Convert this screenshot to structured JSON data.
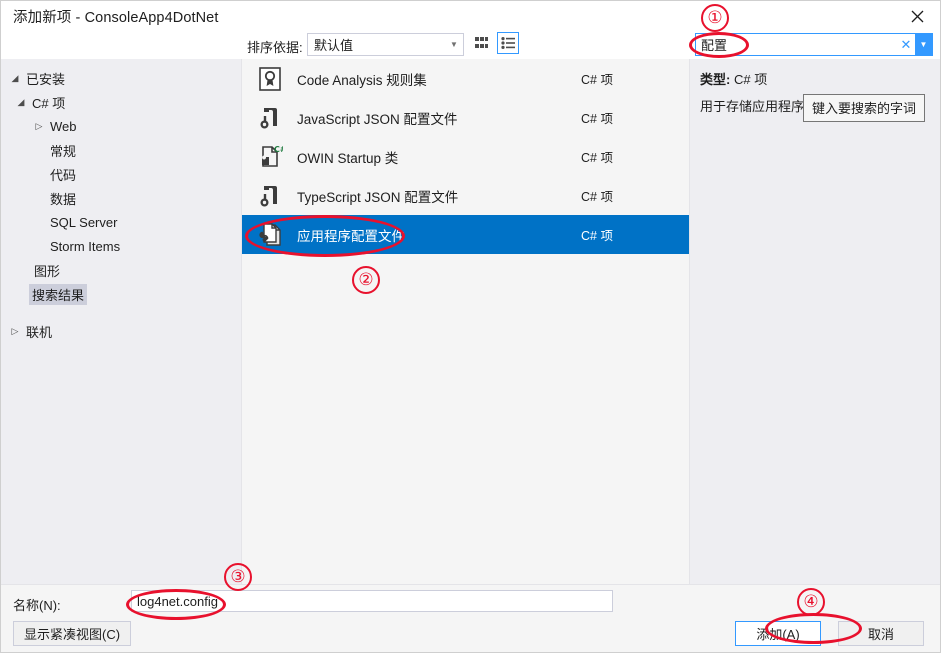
{
  "window": {
    "title": "添加新项 - ConsoleApp4DotNet",
    "close_icon": "close-icon"
  },
  "toolbar": {
    "sort_label": "排序依据:",
    "sort_value": "默认值",
    "sort_options": [
      "默认值"
    ],
    "view_tiles_icon": "grid-view-icon",
    "view_list_icon": "list-view-icon"
  },
  "search": {
    "value": "配置",
    "placeholder": "键入要搜索的字词",
    "clear_icon": "clear-icon",
    "dropdown_icon": "chevron-down-icon",
    "tooltip": "键入要搜索的字词",
    "accent_color": "#3399ff"
  },
  "tree": {
    "root_label": "已安装",
    "items": [
      {
        "label": "C# 项",
        "indent": 0,
        "twisty": "expanded",
        "selected": false
      },
      {
        "label": "Web",
        "indent": 1,
        "twisty": "collapsed",
        "selected": false
      },
      {
        "label": "常规",
        "indent": 1,
        "twisty": "none",
        "selected": false
      },
      {
        "label": "代码",
        "indent": 1,
        "twisty": "none",
        "selected": false
      },
      {
        "label": "数据",
        "indent": 1,
        "twisty": "none",
        "selected": false
      },
      {
        "label": "SQL Server",
        "indent": 1,
        "twisty": "none",
        "selected": false
      },
      {
        "label": "Storm Items",
        "indent": 1,
        "twisty": "none",
        "selected": false
      },
      {
        "label": "图形",
        "indent": 0,
        "twisty": "none",
        "selected": false
      },
      {
        "label": "搜索结果",
        "indent": 0,
        "twisty": "none",
        "selected": true
      },
      {
        "label": "联机",
        "indent": -1,
        "twisty": "collapsed",
        "selected": false
      }
    ]
  },
  "list": {
    "items": [
      {
        "name": "Code Analysis 规则集",
        "kind": "C# 项",
        "icon": "ruleset-icon",
        "selected": false
      },
      {
        "name": "JavaScript JSON 配置文件",
        "kind": "C# 项",
        "icon": "json-file-icon",
        "selected": false
      },
      {
        "name": "OWIN Startup 类",
        "kind": "C# 项",
        "icon": "owin-class-icon",
        "selected": false
      },
      {
        "name": "TypeScript JSON 配置文件",
        "kind": "C# 项",
        "icon": "json-file-icon",
        "selected": false
      },
      {
        "name": "应用程序配置文件",
        "kind": "C# 项",
        "icon": "app-config-icon",
        "selected": true
      }
    ],
    "selection_color": "#0072c6"
  },
  "detail": {
    "type_label": "类型:",
    "type_value": "C# 项",
    "description": "用于存储应用程序配置和设置值的文件"
  },
  "bottom": {
    "name_label": "名称(N):",
    "name_value": "log4net.config",
    "compact_view_button": "显示紧凑视图(C)",
    "add_button": "添加(A)",
    "cancel_button": "取消"
  },
  "annotations": {
    "color": "#e8112d",
    "markers": [
      {
        "num": "①"
      },
      {
        "num": "②"
      },
      {
        "num": "③"
      },
      {
        "num": "④"
      }
    ]
  }
}
